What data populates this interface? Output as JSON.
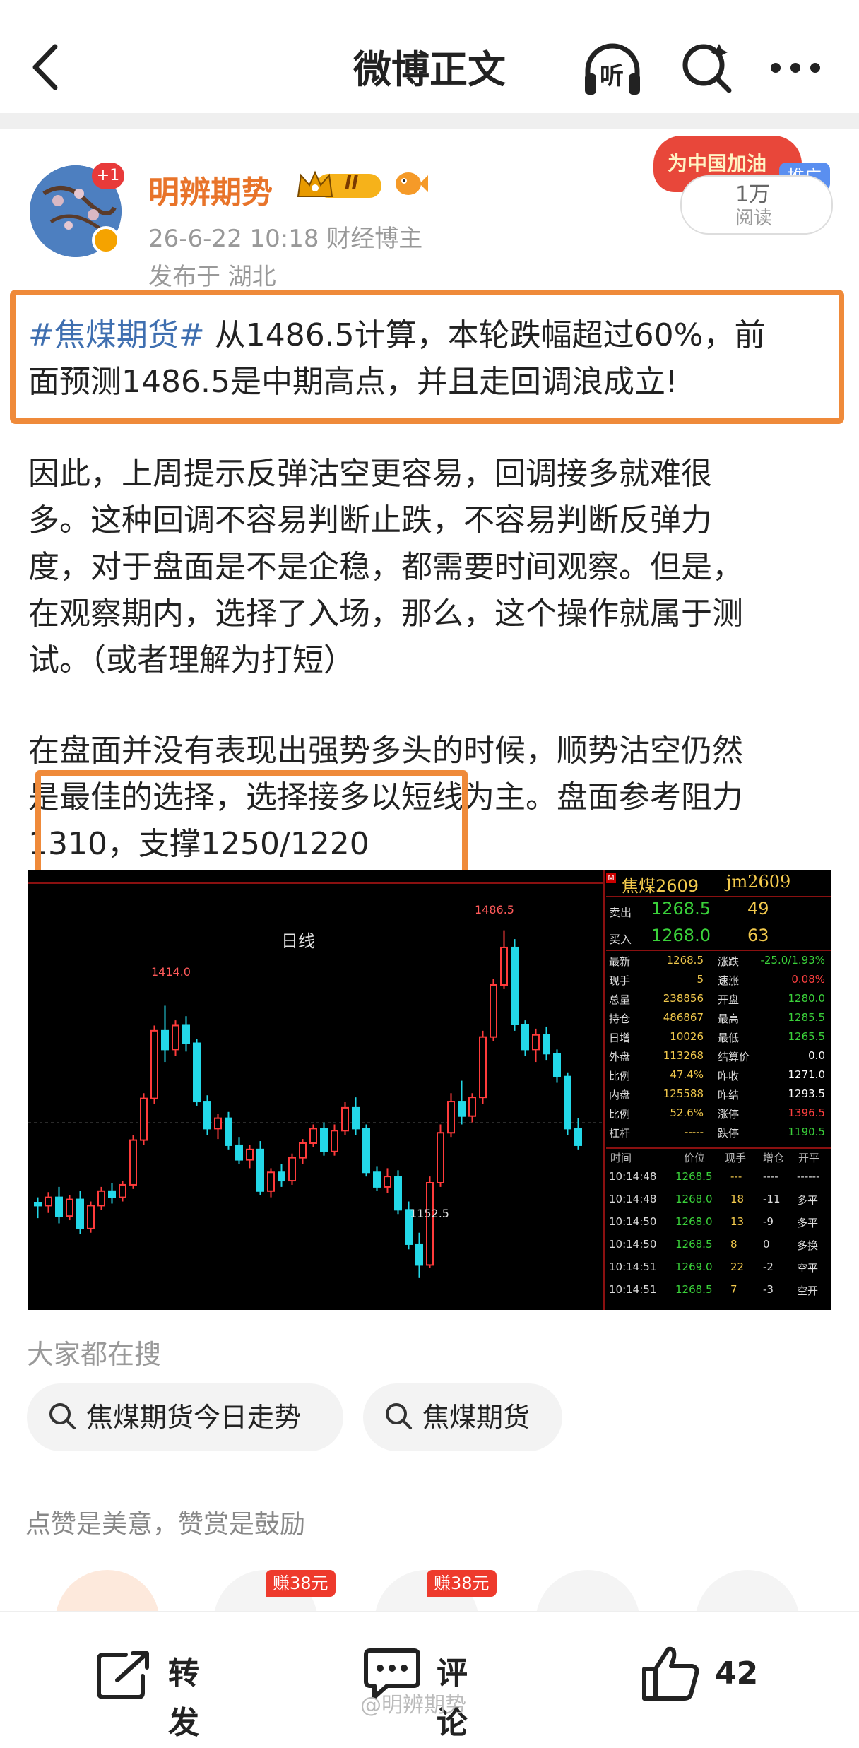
{
  "nav": {
    "title": "微博正文",
    "listen_label": "听"
  },
  "author": {
    "name": "明辨期势",
    "plus_badge": "+1",
    "level_badge": "II",
    "meta": "26-6-22 10:18  财经博主",
    "location": "发布于 湖北"
  },
  "promo": {
    "banner_text": "为中国加油",
    "tag": "推广",
    "reads_count": "1万",
    "reads_label": "阅读"
  },
  "post": {
    "topic": "#焦煤期货#",
    "line1_rest": " 从1486.5计算，本轮跌幅超过60%，前",
    "line2": "面预测1486.5是中期高点，并且走回调浪成立!",
    "p2_lines": [
      "因此，上周提示反弹沽空更容易，回调接多就难很",
      "多。这种回调不容易判断止跌，不容易判断反弹力",
      "度，对于盘面是不是企稳，都需要时间观察。但是，",
      "在观察期内，选择了入场，那么，这个操作就属于测",
      "试。（或者理解为打短）"
    ],
    "p3_lines": [
      "在盘面并没有表现出强势多头的时候，顺势沽空仍然",
      "是最佳的选择，选择接多以短线为主。盘面参考阻力",
      "1310，支撑1250/1220"
    ]
  },
  "chart_data": {
    "type": "candlestick",
    "title": "日线",
    "annotations": [
      "1414.0",
      "1486.5",
      "1152.5"
    ],
    "instrument": "焦煤2609",
    "code": "jm2609",
    "ask": {
      "label": "卖出",
      "price": "1268.5",
      "qty": "49"
    },
    "bid": {
      "label": "买入",
      "price": "1268.0",
      "qty": "63"
    },
    "stats_left": [
      {
        "label": "最新",
        "value": "1268.5"
      },
      {
        "label": "现手",
        "value": "5"
      },
      {
        "label": "总量",
        "value": "238856"
      },
      {
        "label": "持仓",
        "value": "486867"
      },
      {
        "label": "日增",
        "value": "10026"
      },
      {
        "label": "外盘",
        "value": "113268"
      },
      {
        "label": "比例",
        "value": "47.4%"
      },
      {
        "label": "内盘",
        "value": "125588"
      },
      {
        "label": "比例",
        "value": "52.6%"
      },
      {
        "label": "杠杆",
        "value": "-----"
      }
    ],
    "stats_right": [
      {
        "label": "涨跌",
        "value": "-25.0/1.93%",
        "color": "#3ad13a"
      },
      {
        "label": "速涨",
        "value": "0.08%",
        "color": "#ff4040"
      },
      {
        "label": "开盘",
        "value": "1280.0",
        "color": "#3ad13a"
      },
      {
        "label": "最高",
        "value": "1285.5",
        "color": "#3ad13a"
      },
      {
        "label": "最低",
        "value": "1265.5",
        "color": "#3ad13a"
      },
      {
        "label": "结算价",
        "value": "0.0",
        "color": "#ffffff"
      },
      {
        "label": "昨收",
        "value": "1271.0",
        "color": "#ffffff"
      },
      {
        "label": "昨结",
        "value": "1293.5",
        "color": "#ffffff"
      },
      {
        "label": "涨停",
        "value": "1396.5",
        "color": "#ff4040"
      },
      {
        "label": "跌停",
        "value": "1190.5",
        "color": "#3ad13a"
      }
    ],
    "trades_header": [
      "时间",
      "价位",
      "现手",
      "增仓",
      "开平"
    ],
    "trades": [
      {
        "time": "10:14:48",
        "price": "1268.5",
        "qty": "---",
        "oi": "----",
        "type": "------"
      },
      {
        "time": "10:14:48",
        "price": "1268.0",
        "qty": "18",
        "oi": "-11",
        "type": "多平"
      },
      {
        "time": "10:14:50",
        "price": "1268.0",
        "qty": "13",
        "oi": "-9",
        "type": "多平"
      },
      {
        "time": "10:14:50",
        "price": "1268.5",
        "qty": "8",
        "oi": "0",
        "type": "多换"
      },
      {
        "time": "10:14:51",
        "price": "1269.0",
        "qty": "22",
        "oi": "-2",
        "type": "空平"
      },
      {
        "time": "10:14:51",
        "price": "1268.5",
        "qty": "7",
        "oi": "-3",
        "type": "空开"
      }
    ],
    "candles": [
      [
        1225,
        1230,
        1210,
        1222
      ],
      [
        1222,
        1235,
        1215,
        1230
      ],
      [
        1230,
        1240,
        1205,
        1212
      ],
      [
        1212,
        1232,
        1208,
        1228
      ],
      [
        1228,
        1236,
        1195,
        1200
      ],
      [
        1200,
        1226,
        1196,
        1222
      ],
      [
        1222,
        1240,
        1218,
        1236
      ],
      [
        1236,
        1244,
        1224,
        1230
      ],
      [
        1230,
        1246,
        1226,
        1242
      ],
      [
        1242,
        1290,
        1238,
        1285
      ],
      [
        1285,
        1330,
        1280,
        1325
      ],
      [
        1325,
        1395,
        1320,
        1390
      ],
      [
        1390,
        1414,
        1360,
        1372
      ],
      [
        1372,
        1400,
        1366,
        1395
      ],
      [
        1395,
        1404,
        1370,
        1378
      ],
      [
        1378,
        1382,
        1318,
        1322
      ],
      [
        1322,
        1328,
        1290,
        1296
      ],
      [
        1296,
        1310,
        1286,
        1306
      ],
      [
        1306,
        1312,
        1276,
        1280
      ],
      [
        1280,
        1288,
        1262,
        1266
      ],
      [
        1266,
        1280,
        1258,
        1276
      ],
      [
        1276,
        1284,
        1232,
        1236
      ],
      [
        1236,
        1258,
        1230,
        1254
      ],
      [
        1254,
        1262,
        1240,
        1246
      ],
      [
        1246,
        1272,
        1242,
        1268
      ],
      [
        1268,
        1286,
        1262,
        1282
      ],
      [
        1282,
        1300,
        1278,
        1296
      ],
      [
        1296,
        1302,
        1270,
        1274
      ],
      [
        1274,
        1300,
        1270,
        1294
      ],
      [
        1294,
        1322,
        1290,
        1316
      ],
      [
        1316,
        1326,
        1290,
        1296
      ],
      [
        1296,
        1300,
        1250,
        1254
      ],
      [
        1254,
        1260,
        1236,
        1240
      ],
      [
        1240,
        1258,
        1234,
        1250
      ],
      [
        1250,
        1256,
        1214,
        1218
      ],
      [
        1218,
        1226,
        1180,
        1185
      ],
      [
        1185,
        1196,
        1152.5,
        1165
      ],
      [
        1165,
        1250,
        1162,
        1244
      ],
      [
        1244,
        1300,
        1240,
        1292
      ],
      [
        1292,
        1330,
        1288,
        1322
      ],
      [
        1322,
        1342,
        1300,
        1308
      ],
      [
        1308,
        1330,
        1302,
        1326
      ],
      [
        1326,
        1390,
        1320,
        1384
      ],
      [
        1384,
        1440,
        1380,
        1434
      ],
      [
        1434,
        1486.5,
        1430,
        1470
      ],
      [
        1470,
        1478,
        1390,
        1396
      ],
      [
        1396,
        1400,
        1366,
        1372
      ],
      [
        1372,
        1392,
        1360,
        1386
      ],
      [
        1386,
        1394,
        1362,
        1368
      ],
      [
        1368,
        1372,
        1340,
        1346
      ],
      [
        1346,
        1350,
        1290,
        1296
      ],
      [
        1296,
        1306,
        1276,
        1280
      ]
    ],
    "ylim": [
      1130,
      1510
    ]
  },
  "search": {
    "label": "大家都在搜",
    "items": [
      "焦煤期货今日走势",
      "焦煤期货"
    ]
  },
  "reward": {
    "label": "点赞是美意，赞赏是鼓励",
    "earn_badges": [
      "赚38元",
      "赚38元"
    ]
  },
  "bottom": {
    "repost": "转发",
    "comment": "评论",
    "like_count": "42",
    "watermark": "@明辨期势"
  }
}
